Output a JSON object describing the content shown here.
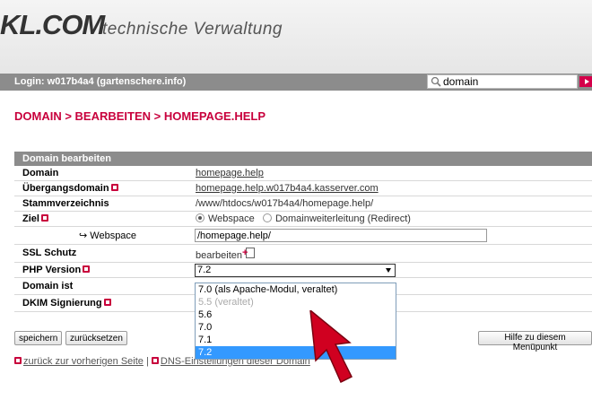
{
  "header": {
    "logo_text": "KL.COM",
    "tagline": "technische Verwaltung"
  },
  "loginbar": {
    "login_text": "Login: w017b4a4 (gartenschere.info)",
    "search_value": "domain",
    "search_icon": "magnifier-icon",
    "go_icon": "arrow-right-icon"
  },
  "breadcrumb": "DOMAIN > BEARBEITEN > HOMEPAGE.HELP",
  "panel": {
    "title": "Domain bearbeiten",
    "rows": {
      "domain": {
        "label": "Domain",
        "value": "homepage.help"
      },
      "uebergang": {
        "label": "Übergangsdomain",
        "value": "homepage.help.w017b4a4.kasserver.com"
      },
      "stamm": {
        "label": "Stammverzeichnis",
        "value": "/www/htdocs/w017b4a4/homepage.help/"
      },
      "ziel": {
        "label": "Ziel",
        "option1": "Webspace",
        "option2": "Domainweiterleitung (Redirect)"
      },
      "webspace": {
        "label": "↪ Webspace",
        "value": "/homepage.help/"
      },
      "ssl": {
        "label": "SSL Schutz",
        "value": "bearbeiten"
      },
      "php": {
        "label": "PHP Version",
        "selected": "7.2"
      },
      "domainist": {
        "label": "Domain ist"
      },
      "dkim": {
        "label": "DKIM Signierung"
      }
    }
  },
  "php_options": [
    {
      "label": "7.0 (als Apache-Modul, veraltet)",
      "state": "normal"
    },
    {
      "label": "5.5 (veraltet)",
      "state": "disabled"
    },
    {
      "label": "5.6",
      "state": "normal"
    },
    {
      "label": "7.0",
      "state": "normal"
    },
    {
      "label": "7.1",
      "state": "normal"
    },
    {
      "label": "7.2",
      "state": "selected"
    }
  ],
  "buttons": {
    "save": "speichern",
    "reset": "zurücksetzen",
    "help": "Hilfe zu diesem Menüpunkt"
  },
  "footer": {
    "back_link": "zurück zur vorherigen Seite",
    "separator": "|",
    "dns_link": "DNS-Einstellungen dieser Domain"
  },
  "colors": {
    "accent": "#c8003c",
    "bar": "#8c8c8c",
    "selection": "#3399ff"
  }
}
